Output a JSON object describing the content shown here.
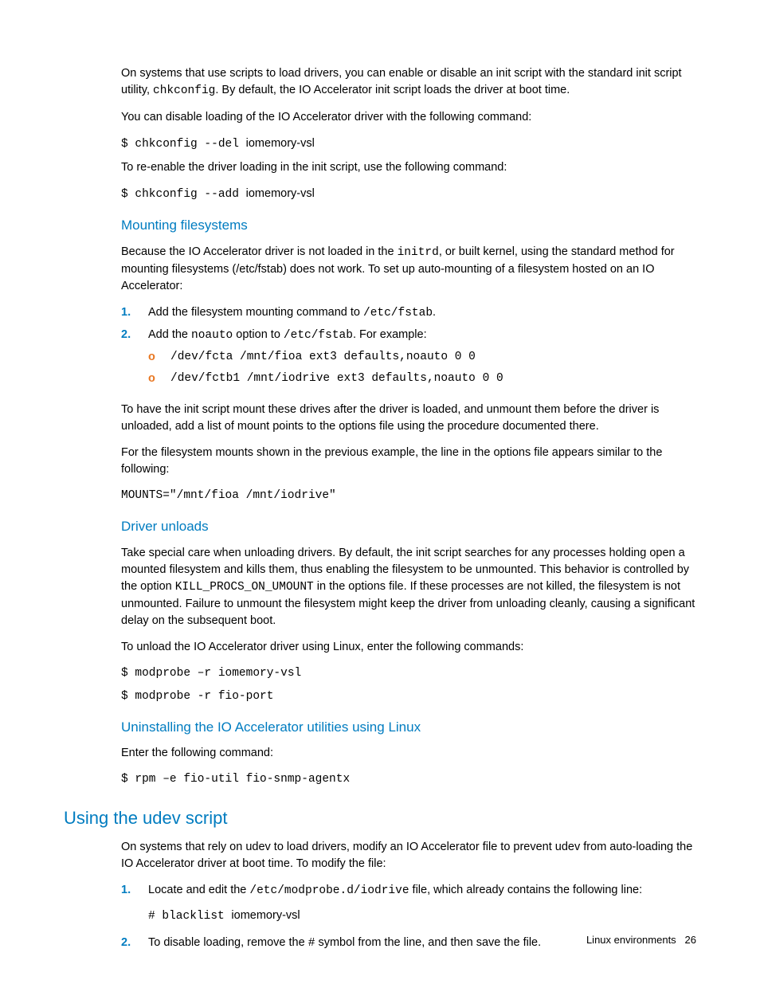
{
  "intro": {
    "p1a": "On systems that use scripts to load drivers, you can enable or disable an init script with the standard init script utility, ",
    "p1code": "chkconfig",
    "p1b": ". By default, the IO Accelerator init script loads the driver at boot time.",
    "p2": "You can disable loading of the IO Accelerator driver with the following command:",
    "cmd1pre": "$ chkconfig --del ",
    "cmd1post": "iomemory-vsl",
    "p3": "To re-enable the driver loading in the init script, use the following command:",
    "cmd2pre": "$ chkconfig --add ",
    "cmd2post": "iomemory-vsl"
  },
  "mounting": {
    "heading": "Mounting filesystems",
    "p1a": "Because the IO Accelerator driver is not loaded in the ",
    "p1code": "initrd",
    "p1b": ", or built kernel, using the standard method for mounting filesystems (/etc/fstab) does not work. To set up auto-mounting of a filesystem hosted on an IO Accelerator:",
    "list": {
      "n1": "1.",
      "li1a": "Add the filesystem mounting command to ",
      "li1code": "/etc/fstab",
      "li1b": ".",
      "n2": "2.",
      "li2a": "Add the ",
      "li2code1": "noauto",
      "li2b": " option to ",
      "li2code2": "/etc/fstab",
      "li2c": ". For example:",
      "bul": "o",
      "sub1": "/dev/fcta /mnt/fioa ext3 defaults,noauto 0 0",
      "sub2": "/dev/fctb1 /mnt/iodrive ext3 defaults,noauto 0 0"
    },
    "p2": "To have the init script mount these drives after the driver is loaded, and unmount them before the driver is unloaded, add a list of mount points to the options file using the procedure documented there.",
    "p3": "For the filesystem mounts shown in the previous example, the line in the options file appears similar to the following:",
    "cmd": "MOUNTS=\"/mnt/fioa /mnt/iodrive\""
  },
  "unloads": {
    "heading": "Driver unloads",
    "p1a": "Take special care when unloading drivers. By default, the init script searches for any processes holding open a mounted filesystem and kills them, thus enabling the filesystem to be unmounted. This behavior is controlled by the option ",
    "p1code": "KILL_PROCS_ON_UMOUNT",
    "p1b": " in the options file. If these processes are not killed, the filesystem is not unmounted. Failure to unmount the filesystem might keep the driver from unloading cleanly, causing a significant delay on the subsequent boot.",
    "p2": "To unload the IO Accelerator driver using Linux, enter the following commands:",
    "cmd1": "$ modprobe –r iomemory-vsl",
    "cmd2": "$ modprobe -r fio-port"
  },
  "uninstall": {
    "heading": "Uninstalling the IO Accelerator utilities using Linux",
    "p1": "Enter the following command:",
    "cmd": "$ rpm –e fio-util fio-snmp-agentx"
  },
  "udev": {
    "heading": "Using the udev script",
    "p1": "On systems that rely on udev to load drivers, modify an IO Accelerator file to prevent udev from auto-loading the IO Accelerator driver at boot time. To modify the file:",
    "list": {
      "n1": "1.",
      "li1a": "Locate and edit the ",
      "li1code": "/etc/modprobe.d/iodrive",
      "li1b": " file, which already contains the following line:",
      "sub1pre": "# blacklist ",
      "sub1post": "iomemory-vsl",
      "n2": "2.",
      "li2a": "To disable loading, remove the ",
      "li2code": "#",
      "li2b": " symbol from the line, and then save the file."
    }
  },
  "footer": {
    "text": "Linux environments",
    "page": "26"
  }
}
